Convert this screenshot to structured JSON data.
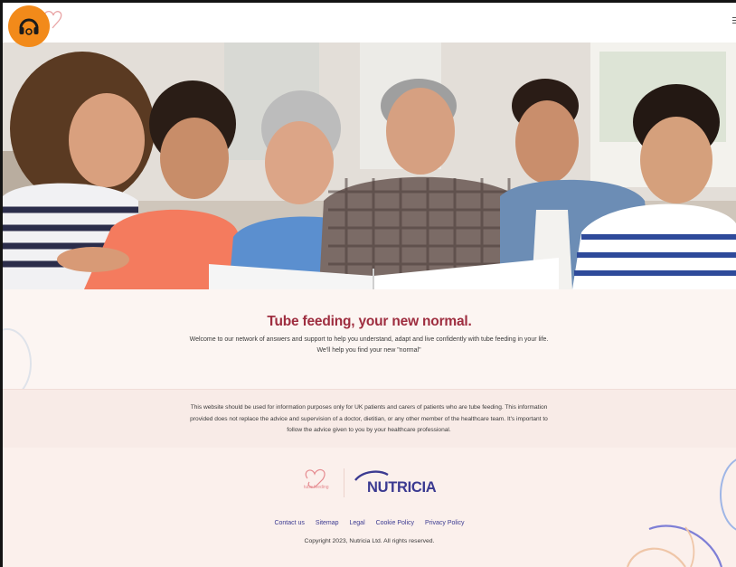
{
  "header": {
    "logo_icon": "headphones-icon",
    "brand_color": "#f28a1a",
    "menu_icon": "hamburger-icon"
  },
  "hero": {
    "image_subject": "family-photo"
  },
  "intro": {
    "title": "Tube feeding, your new normal.",
    "text": "Welcome to our network of answers and support to help you understand, adapt and live confidently with tube feeding in your life. We'll help you find your new \"normal\"",
    "title_color": "#9e2d3f"
  },
  "disclaimer": {
    "text": "This website should be used for information purposes only for UK patients and carers of patients who are tube feeding. This information provided does not replace the advice and supervision of a doctor, dietitian, or any other member of the healthcare team. It's important to follow the advice given to you by your healthcare professional."
  },
  "footer": {
    "tube_feeding_logo_text": "tube feeding",
    "nutricia_logo_text": "NUTRICIA",
    "nutricia_color": "#3b3a91",
    "links": [
      "Contact us",
      "Sitemap",
      "Legal",
      "Cookie Policy",
      "Privacy Policy"
    ],
    "copyright": "Copyright 2023, Nutricia Ltd. All rights reserved."
  }
}
